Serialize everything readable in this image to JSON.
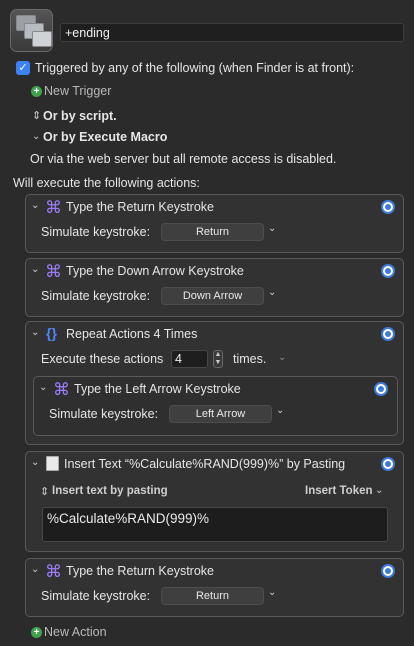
{
  "macro": {
    "name": "+ending"
  },
  "triggers": {
    "triggered_label": "Triggered by any of the following (when Finder is at front):",
    "new_trigger": "New Trigger",
    "or_by_script": "Or by script.",
    "or_by_execute_macro": "Or by Execute Macro",
    "web_server_note": "Or via the web server but all remote access is disabled."
  },
  "actions_header": "Will execute the following actions:",
  "actions": [
    {
      "title": "Type the Return Keystroke",
      "label": "Simulate keystroke:",
      "key": "Return"
    },
    {
      "title": "Type the Down Arrow Keystroke",
      "label": "Simulate keystroke:",
      "key": "Down Arrow"
    },
    {
      "title": "Repeat Actions 4 Times",
      "execute_label": "Execute these actions",
      "count": "4",
      "times_label": "times.",
      "inner": {
        "title": "Type the Left Arrow Keystroke",
        "label": "Simulate keystroke:",
        "key": "Left Arrow"
      }
    },
    {
      "title": "Insert Text “%Calculate%RAND(999)%” by Pasting",
      "mode": "Insert text by pasting",
      "insert_token": "Insert Token",
      "text": "%Calculate%RAND(999)%"
    },
    {
      "title": "Type the Return Keystroke",
      "label": "Simulate keystroke:",
      "key": "Return"
    }
  ],
  "new_action": "New Action",
  "colors": {
    "accent": "#3b82f6",
    "keystroke_icon": "#9d7cff",
    "add_green": "#3fa34d"
  },
  "icons": [
    "macro-icon",
    "checkmark-icon",
    "plus-circle-icon",
    "updown-chevron-icon",
    "chevron-down-icon",
    "command-icon",
    "gear-icon",
    "braces-icon",
    "clipboard-icon"
  ]
}
